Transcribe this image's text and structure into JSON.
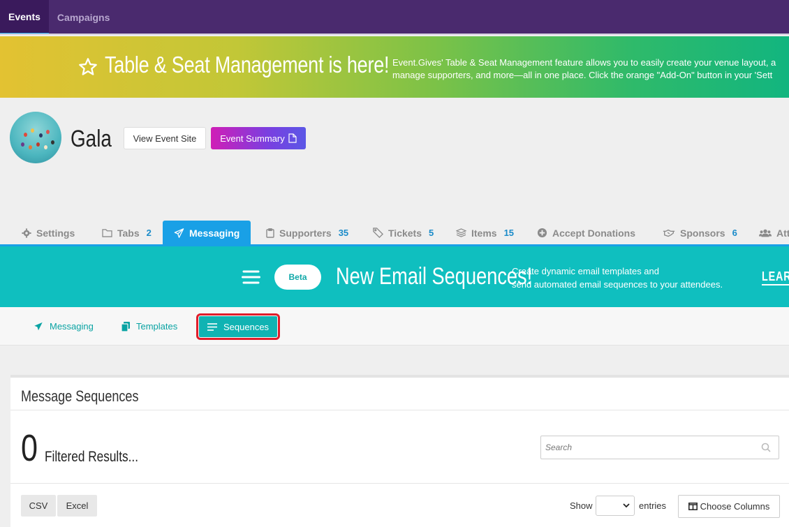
{
  "topnav": {
    "tabs": [
      {
        "label": "Events",
        "active": true
      },
      {
        "label": "Campaigns",
        "active": false
      }
    ]
  },
  "banner": {
    "headline": "Table & Seat Management is here!",
    "desc_line1": "Event.Gives' Table & Seat Management feature allows you to easily create your venue layout, a",
    "desc_line2": "manage supporters, and more—all in one place. Click the orange \"Add-On\" button in your 'Sett",
    "icon": "star-outline-icon"
  },
  "event": {
    "name": "Gala",
    "view_site_label": "View Event Site",
    "summary_label": "Event Summary",
    "summary_icon": "pdf-file-icon"
  },
  "event_tabs": [
    {
      "label": "Settings",
      "count": "",
      "icon": "gear-icon",
      "active": false
    },
    {
      "label": "Tabs",
      "count": "2",
      "icon": "folder-icon",
      "active": false
    },
    {
      "label": "Messaging",
      "count": "",
      "icon": "paper-plane-icon",
      "active": true
    },
    {
      "label": "Supporters",
      "count": "35",
      "icon": "clipboard-icon",
      "active": false
    },
    {
      "label": "Tickets",
      "count": "5",
      "icon": "ticket-icon",
      "active": false
    },
    {
      "label": "Items",
      "count": "15",
      "icon": "layers-icon",
      "active": false
    },
    {
      "label": "Accept Donations",
      "count": "",
      "icon": "plus-circle-icon",
      "active": false
    },
    {
      "label": "Sponsors",
      "count": "6",
      "icon": "handshake-icon",
      "active": false
    },
    {
      "label": "Att",
      "count": "",
      "icon": "users-icon",
      "active": false
    }
  ],
  "promo": {
    "badge": "Beta",
    "title": "New Email Sequences!",
    "sub_line1": "Create dynamic email templates and",
    "sub_line2": "send automated email sequences to your attendees.",
    "learn": "LEARN"
  },
  "subnav": [
    {
      "label": "Messaging",
      "icon": "paper-plane-icon",
      "active": false
    },
    {
      "label": "Templates",
      "icon": "copy-icon",
      "active": false
    },
    {
      "label": "Sequences",
      "icon": "list-icon",
      "active": true
    }
  ],
  "card": {
    "title": "Message Sequences",
    "count": "0",
    "count_label": "Filtered Results...",
    "search_placeholder": "Search",
    "csv_label": "CSV",
    "excel_label": "Excel",
    "show_label": "Show",
    "entries_label": "entries",
    "entries_value": "",
    "choose_columns_label": "Choose Columns"
  },
  "colors": {
    "topnav_bg": "#4a2a6e",
    "accent_blue": "#19a0e6",
    "teal": "#0fbfbf",
    "highlight_red": "#e11d2a"
  }
}
